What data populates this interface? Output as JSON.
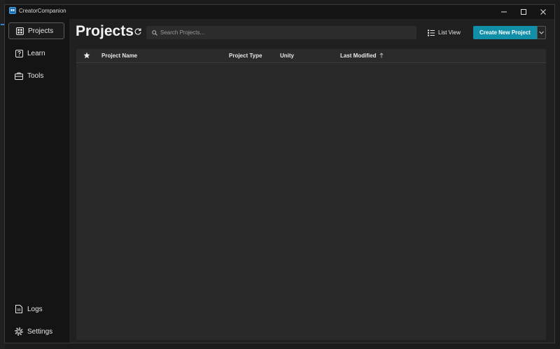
{
  "window": {
    "title": "CreatorCompanion"
  },
  "sidebar": {
    "items": [
      {
        "label": "Projects",
        "icon": "grid-icon",
        "active": true
      },
      {
        "label": "Learn",
        "icon": "question-icon",
        "active": false
      },
      {
        "label": "Tools",
        "icon": "toolbox-icon",
        "active": false
      }
    ],
    "bottom_items": [
      {
        "label": "Logs",
        "icon": "document-icon"
      },
      {
        "label": "Settings",
        "icon": "gear-icon"
      }
    ]
  },
  "main": {
    "title": "Projects",
    "search": {
      "placeholder": "Search Projects...",
      "value": ""
    },
    "view_toggle_label": "List View",
    "create_button_label": "Create New Project",
    "table": {
      "columns": [
        "Project Name",
        "Project Type",
        "Unity",
        "Last Modified"
      ],
      "sort_column": "Last Modified",
      "sort_direction": "ascending",
      "rows": []
    }
  },
  "colors": {
    "accent": "#118ea8",
    "window_bg": "#141414",
    "content_bg": "#202020",
    "table_bg": "#292929"
  }
}
